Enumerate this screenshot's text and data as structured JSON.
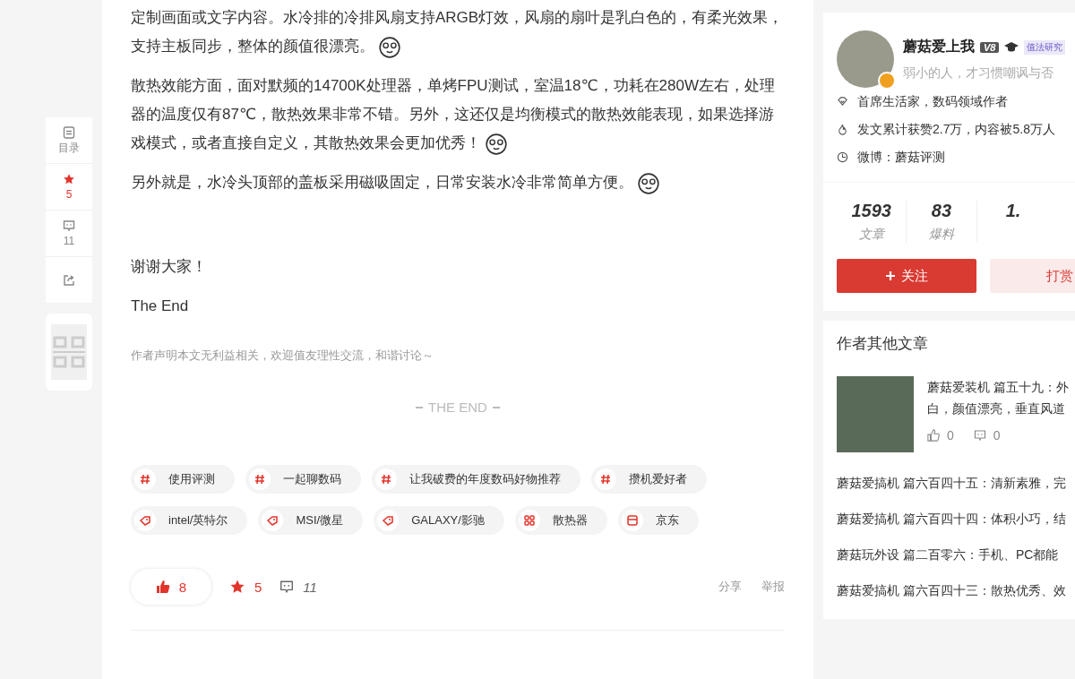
{
  "side_toolbar": [
    {
      "kind": "toc",
      "label": "目录"
    },
    {
      "kind": "favorite",
      "label": "5"
    },
    {
      "kind": "comment",
      "label": "11"
    },
    {
      "kind": "share"
    }
  ],
  "article": {
    "paragraphs": [
      {
        "text": "定制画面或文字内容。水冷排的冷排风扇支持ARGB灯效，风扇的扇叶是乳白色的，有柔光效果，支持主板同步，整体的颜值很漂亮。",
        "emoji": true
      },
      {
        "text": "散热效能方面，面对默频的14700K处理器，单烤FPU测试，室温18℃，功耗在280W左右，处理器的温度仅有87℃，散热效果非常不错。另外，这还仅是均衡模式的散热效能表现，如果选择游戏模式，或者直接自定义，其散热效果会更加优秀！",
        "emoji": true
      },
      {
        "text": "另外就是，水冷头顶部的盖板采用磁吸固定，日常安装水冷非常简单方便。",
        "emoji": true
      }
    ],
    "closing": [
      "谢谢大家！",
      "The End"
    ],
    "disclaimer": "作者声明本文无利益相关，欢迎值友理性交流，和谐讨论～",
    "end_mark": "THE END",
    "tags": [
      [
        {
          "kind": "topic",
          "label": "使用评测"
        },
        {
          "kind": "topic",
          "label": "一起聊数码"
        },
        {
          "kind": "topic",
          "label": "让我破费的年度数码好物推荐"
        },
        {
          "kind": "topic",
          "label": "攒机爱好者"
        }
      ],
      [
        {
          "kind": "brand",
          "label": "intel/英特尔"
        },
        {
          "kind": "brand",
          "label": "MSI/微星"
        },
        {
          "kind": "brand",
          "label": "GALAXY/影驰"
        },
        {
          "kind": "category",
          "label": "散热器"
        },
        {
          "kind": "store",
          "label": "京东"
        }
      ]
    ],
    "actions": {
      "likes": "8",
      "favorites": "5",
      "comments": "11",
      "share": "分享",
      "report": "举报"
    }
  },
  "author": {
    "name": "蘑菇爱上我",
    "level": "V8",
    "badge": "值法研究",
    "motto": "弱小的人，才习惯嘲讽与否",
    "facts": [
      {
        "kind": "title",
        "text": "首席生活家，数码领域作者"
      },
      {
        "kind": "likes",
        "text": "发文累计获赞2.7万，内容被5.8万人"
      },
      {
        "kind": "weibo",
        "text": "微博：蘑菇评测"
      }
    ],
    "stats": [
      {
        "value": "1593",
        "label": "文章"
      },
      {
        "value": "83",
        "label": "爆料"
      },
      {
        "value": "1."
      }
    ],
    "follow": "关注",
    "tip": "打赏"
  },
  "other_articles": {
    "title": "作者其他文章",
    "featured": {
      "title_lines": [
        "蘑菇爱装机 篇五十九：外",
        "白，颜值漂亮，垂直风道"
      ],
      "likes": "0",
      "comments": "0"
    },
    "list": [
      "蘑菇爱搞机 篇六百四十五：清新素雅，完",
      "蘑菇爱搞机 篇六百四十四：体积小巧，结",
      "蘑菇玩外设 篇二百零六：手机、PC都能",
      "蘑菇爱搞机 篇六百四十三：散热优秀、效"
    ]
  }
}
